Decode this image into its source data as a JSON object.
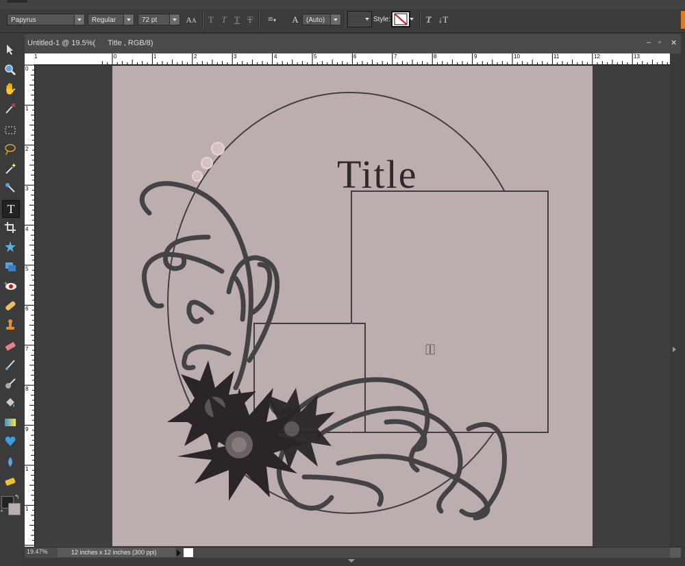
{
  "options_bar": {
    "font_family": "Papyrus",
    "font_style": "Regular",
    "font_size": "72 pt",
    "leading": "(Auto)",
    "style_label": "Style:"
  },
  "document": {
    "tab_title": "Untitled-1 @ 19.5%(      Title , RGB/8)",
    "zoom": "19.47%",
    "doc_info": "12 inches x 12 inches (300 ppi)",
    "canvas_title_text": "Title",
    "window_controls": [
      "–",
      "▫",
      "✕"
    ]
  },
  "ruler": {
    "horizontal_labels": [
      "1",
      "0",
      "1",
      "2",
      "3",
      "4",
      "5",
      "6",
      "7",
      "8",
      "9",
      "10",
      "11",
      "12",
      "13"
    ],
    "vertical_labels": [
      "0",
      "1",
      "2",
      "3",
      "4",
      "5",
      "6",
      "7",
      "8",
      "9",
      "1",
      "1"
    ]
  },
  "tools": [
    {
      "icon": "move-icon"
    },
    {
      "icon": "zoom-icon"
    },
    {
      "icon": "hand-icon"
    },
    {
      "icon": "eyedropper-icon"
    },
    {
      "icon": "marquee-icon"
    },
    {
      "icon": "lasso-icon"
    },
    {
      "icon": "magic-wand-icon"
    },
    {
      "icon": "quick-selection-icon"
    },
    {
      "icon": "type-icon"
    },
    {
      "icon": "crop-icon"
    },
    {
      "icon": "cookie-cutter-icon"
    },
    {
      "icon": "straighten-icon"
    },
    {
      "icon": "red-eye-icon"
    },
    {
      "icon": "healing-brush-icon"
    },
    {
      "icon": "clone-stamp-icon"
    },
    {
      "icon": "eraser-icon"
    },
    {
      "icon": "brush-icon"
    },
    {
      "icon": "smart-brush-icon"
    },
    {
      "icon": "paint-bucket-icon"
    },
    {
      "icon": "gradient-icon"
    },
    {
      "icon": "shape-icon"
    },
    {
      "icon": "blur-icon"
    },
    {
      "icon": "sponge-icon"
    }
  ],
  "colors": {
    "canvas": "#bcaeae",
    "frame_stroke": "#3f3f3f",
    "flower": "#2a2627",
    "swirl": "#444343",
    "foreground": "#222222",
    "background": "#bcaeae"
  }
}
